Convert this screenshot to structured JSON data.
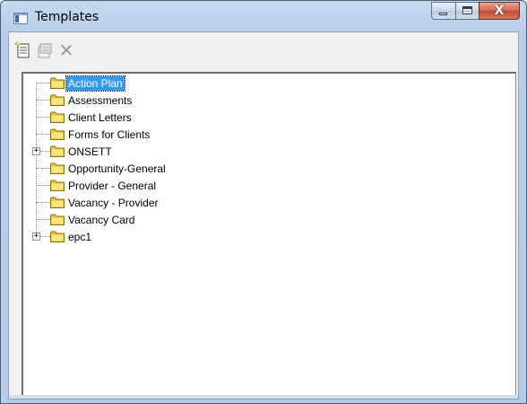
{
  "window": {
    "title": "Templates",
    "close_glyph": "X",
    "colors": {
      "selection": "#3399ff",
      "title_bar": "#b9cfe9",
      "close_button": "#c24a2f"
    }
  },
  "toolbar": {
    "buttons": [
      {
        "name": "new-template-icon"
      },
      {
        "name": "properties-icon"
      },
      {
        "name": "delete-icon",
        "glyph": "✕"
      }
    ]
  },
  "tree": {
    "items": [
      {
        "label": "Action Plan",
        "selected": true,
        "expandable": false
      },
      {
        "label": "Assessments",
        "selected": false,
        "expandable": false
      },
      {
        "label": "Client Letters",
        "selected": false,
        "expandable": false
      },
      {
        "label": "Forms for Clients",
        "selected": false,
        "expandable": false
      },
      {
        "label": "ONSETT",
        "selected": false,
        "expandable": true
      },
      {
        "label": "Opportunity-General",
        "selected": false,
        "expandable": false
      },
      {
        "label": "Provider - General",
        "selected": false,
        "expandable": false
      },
      {
        "label": "Vacancy - Provider",
        "selected": false,
        "expandable": false
      },
      {
        "label": "Vacancy Card",
        "selected": false,
        "expandable": false
      },
      {
        "label": "epc1",
        "selected": false,
        "expandable": true
      }
    ],
    "expander_glyph": "+"
  }
}
